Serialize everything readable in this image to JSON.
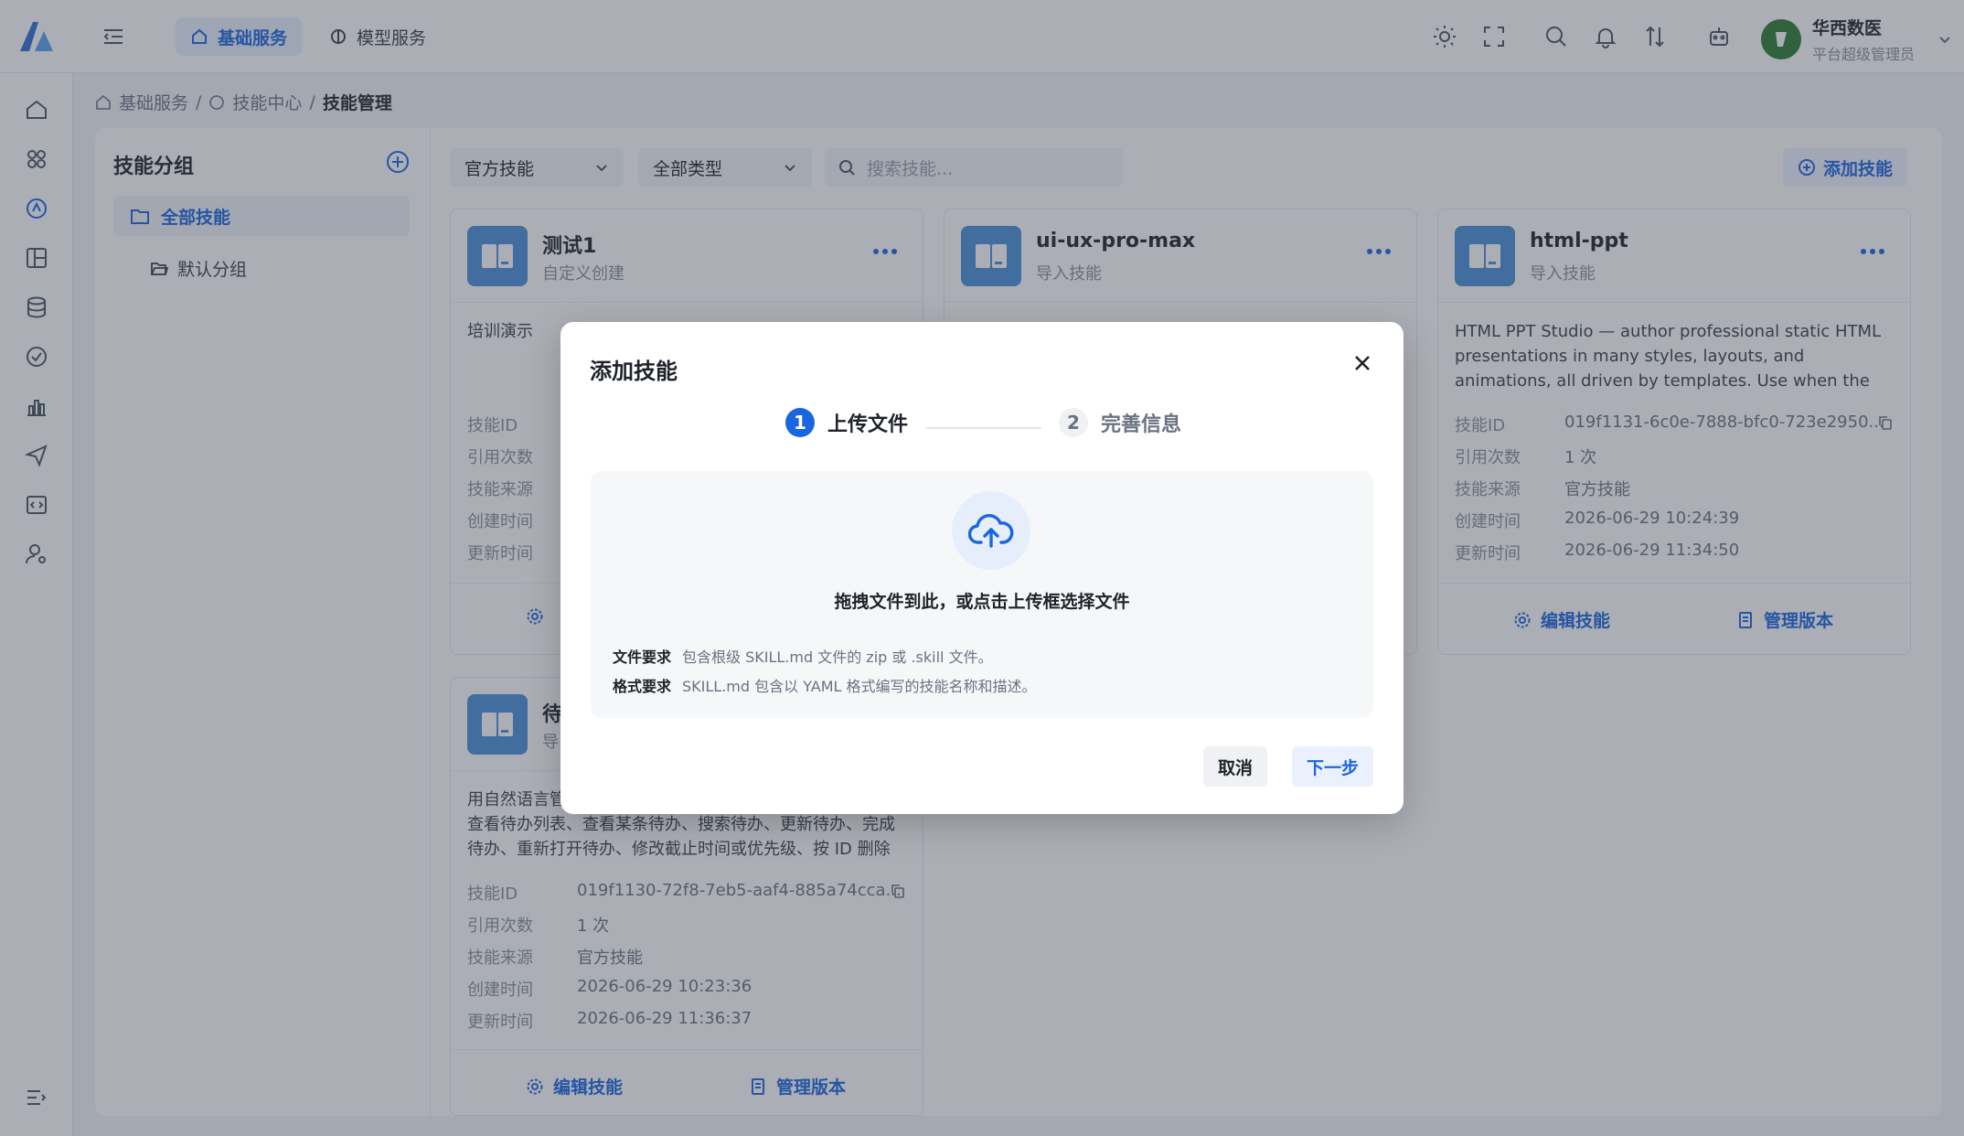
{
  "header": {
    "tabs": [
      {
        "label": "基础服务",
        "active": true
      },
      {
        "label": "模型服务",
        "active": false
      }
    ],
    "user": {
      "name": "华西数医",
      "role": "平台超级管理员"
    }
  },
  "breadcrumb": {
    "items": [
      "基础服务",
      "技能中心",
      "技能管理"
    ],
    "sep": "/"
  },
  "sidebar": {
    "title": "技能分组",
    "items": [
      {
        "label": "全部技能",
        "active": true
      },
      {
        "label": "默认分组",
        "active": false
      }
    ]
  },
  "filters": {
    "source": "官方技能",
    "type": "全部类型",
    "search_placeholder": "搜索技能...",
    "add_label": "添加技能"
  },
  "meta_labels": {
    "id": "技能ID",
    "refs": "引用次数",
    "source": "技能来源",
    "created": "创建时间",
    "updated": "更新时间"
  },
  "card_actions": {
    "edit": "编辑技能",
    "versions": "管理版本"
  },
  "cards": [
    {
      "name": "测试1",
      "type": "自定义创建",
      "desc": "培训演示"
    },
    {
      "name": "ui-ux-pro-max",
      "type": "导入技能"
    },
    {
      "name": "html-ppt",
      "type": "导入技能",
      "desc": "HTML PPT Studio — author professional static HTML presentations in many styles, layouts, and animations, all driven by templates. Use when the user asks for a presenta...",
      "id": "019f1131-6c0e-7888-bfc0-723e2950...",
      "refs": "1 次",
      "source": "官方技能",
      "created": "2026-06-29 10:24:39",
      "updated": "2026-06-29 11:34:50"
    },
    {
      "name": "待",
      "type": "导",
      "desc": "用自然语言管\n查看待办列表、查看某条待办、搜索待办、更新待办、完成待办、重新打开待办、修改截止时间或优先级、按 ID 删除单...",
      "id": "019f1130-72f8-7eb5-aaf4-885a74cca...",
      "refs": "1 次",
      "source": "官方技能",
      "created": "2026-06-29 10:23:36",
      "updated": "2026-06-29 11:36:37"
    }
  ],
  "modal": {
    "title": "添加技能",
    "steps": [
      {
        "num": "1",
        "label": "上传文件",
        "active": true
      },
      {
        "num": "2",
        "label": "完善信息",
        "active": false
      }
    ],
    "drop_text": "拖拽文件到此，或点击上传框选择文件",
    "requirements": [
      {
        "label": "文件要求",
        "text": "包含根级 SKILL.md 文件的 zip 或 .skill 文件。"
      },
      {
        "label": "格式要求",
        "text": "SKILL.md 包含以 YAML 格式编写的技能名称和描述。"
      }
    ],
    "cancel": "取消",
    "next": "下一步"
  },
  "colors": {
    "accent": "#1a66e0",
    "overlay": "rgba(55,62,78,0.42)",
    "card_icon": "#4a90d9"
  }
}
